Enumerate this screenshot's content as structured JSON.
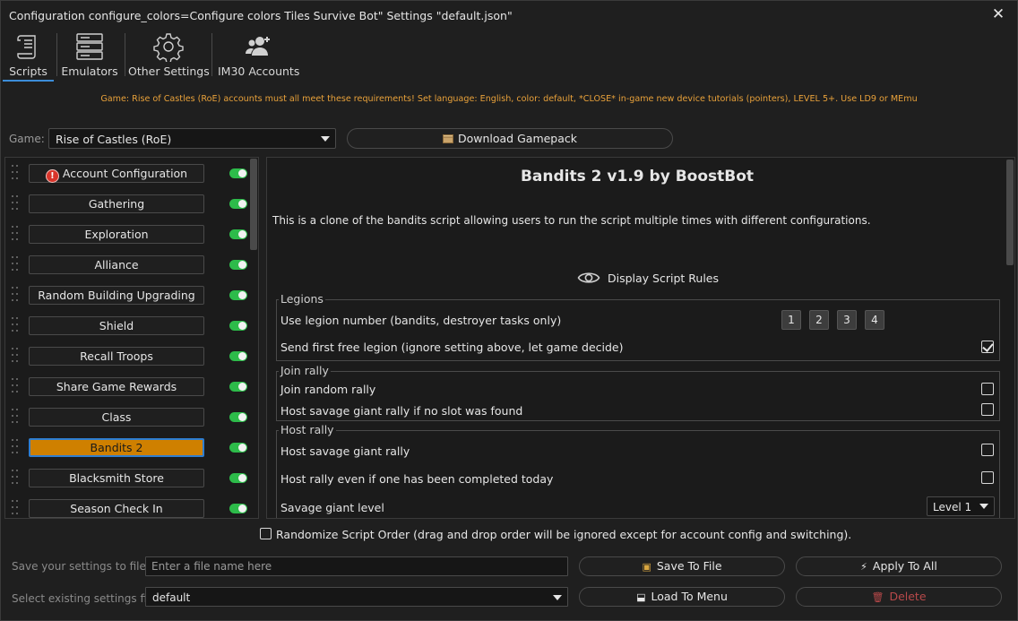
{
  "window": {
    "title": "Configuration configure_colors=Configure colors Tiles Survive Bot\" Settings \"default.json\""
  },
  "tabs": [
    {
      "label": "Scripts",
      "icon": "scroll-icon",
      "active": true
    },
    {
      "label": "Emulators",
      "icon": "server-icon"
    },
    {
      "label": "Other Settings",
      "icon": "gear-icon"
    },
    {
      "label": "IM30 Accounts",
      "icon": "users-icon"
    }
  ],
  "notice": "Game: Rise of Castles (RoE) accounts must all meet these requirements! Set language: English, color: default, *CLOSE* in-game new device tutorials (pointers), LEVEL 5+. Use LD9 or MEmu",
  "game": {
    "label": "Game:",
    "selected": "Rise of Castles (RoE)",
    "download_label": "Download Gamepack"
  },
  "scripts": [
    {
      "label": "Account Configuration",
      "enabled": true,
      "alert": true
    },
    {
      "label": "Gathering",
      "enabled": true
    },
    {
      "label": "Exploration",
      "enabled": true
    },
    {
      "label": "Alliance",
      "enabled": true
    },
    {
      "label": "Random Building Upgrading",
      "enabled": true
    },
    {
      "label": "Shield",
      "enabled": true
    },
    {
      "label": "Recall Troops",
      "enabled": true
    },
    {
      "label": "Share Game Rewards",
      "enabled": true
    },
    {
      "label": "Class",
      "enabled": true
    },
    {
      "label": "Bandits 2",
      "enabled": true,
      "selected": true
    },
    {
      "label": "Blacksmith Store",
      "enabled": true
    },
    {
      "label": "Season Check In",
      "enabled": true
    }
  ],
  "detail": {
    "title": "Bandits 2 v1.9 by BoostBot",
    "description": "This is a clone of the bandits script allowing users to run the script multiple times with different configurations.",
    "rules_label": "Display Script Rules",
    "legions": {
      "title": "Legions",
      "use_legion_label": "Use legion number (bandits, destroyer tasks only)",
      "legion_buttons": [
        "1",
        "2",
        "3",
        "4"
      ],
      "send_free_label": "Send first free legion (ignore setting above, let game decide)",
      "send_free_checked": true
    },
    "join_rally": {
      "title": "Join rally",
      "join_random_label": "Join random rally",
      "join_random_checked": false,
      "host_if_no_slot_label": "Host savage giant rally if no slot was found",
      "host_if_no_slot_checked": false
    },
    "host_rally": {
      "title": "Host rally",
      "host_savage_label": "Host savage giant rally",
      "host_savage_checked": false,
      "host_even_label": "Host rally even if one has been completed today",
      "host_even_checked": false,
      "level_label": "Savage giant level",
      "level_value": "Level 1"
    }
  },
  "randomize_label": "Randomize Script Order (drag and drop order will be ignored except for account config and switching).",
  "save": {
    "label": "Save your settings to file",
    "placeholder": "Enter a file name here",
    "save_button": "Save To File",
    "apply_button": "Apply To All"
  },
  "load": {
    "label": "Select existing settings file",
    "selected": "default",
    "load_button": "Load To Menu",
    "delete_button": "Delete"
  },
  "colors": {
    "accent": "#3c8dd9",
    "notice": "#e8a13a",
    "toggle_on": "#2dbb4a",
    "selected_script": "#cf8000",
    "delete": "#b8494a",
    "alert": "#d9352b"
  }
}
